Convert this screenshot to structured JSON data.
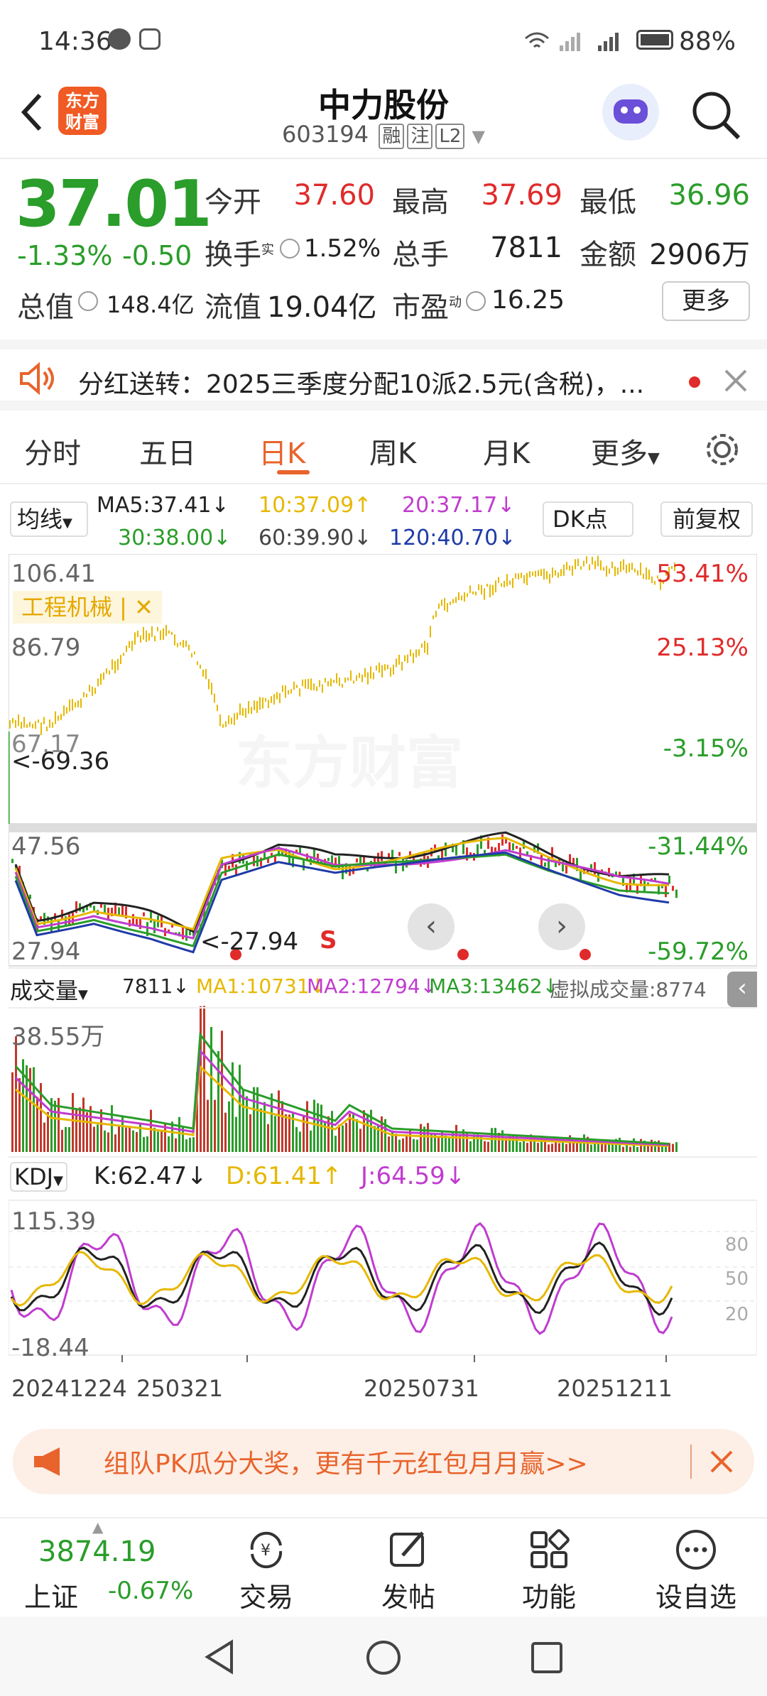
{
  "status": {
    "time": "14:36",
    "battery": "88%"
  },
  "header": {
    "title": "中力股份",
    "code": "603194",
    "tags": [
      "融",
      "注",
      "L2"
    ],
    "logo_line1": "东方",
    "logo_line2": "财富"
  },
  "quote": {
    "price": "37.01",
    "change_pct": "-1.33%",
    "change": "-0.50",
    "open_label": "今开",
    "open": "37.60",
    "high_label": "最高",
    "high": "37.69",
    "low_label": "最低",
    "low": "36.96",
    "turnover_label": "换手",
    "turnover_sup": "实",
    "turnover": "1.52%",
    "volume_label": "总手",
    "volume": "7811",
    "amount_label": "金额",
    "amount": "2906万",
    "mktcap_label": "总值",
    "mktcap": "148.4亿",
    "float_label": "流值",
    "float": "19.04亿",
    "pe_label": "市盈",
    "pe_sup": "动",
    "pe": "16.25",
    "more": "更多"
  },
  "notice": {
    "text": "分红送转：2025三季度分配10派2.5元(含税)，..."
  },
  "tabs": [
    "分时",
    "五日",
    "日K",
    "周K",
    "月K",
    "更多"
  ],
  "active_tab": "日K",
  "ma_bar": {
    "select": "均线",
    "ma5": "MA5:37.41↓",
    "ma10": "10:37.09↑",
    "ma20": "20:37.17↓",
    "ma30": "30:38.00↓",
    "ma60": "60:39.90↓",
    "ma120": "120:40.70↓",
    "dk": "DK点",
    "adjust": "前复权"
  },
  "upper_chart": {
    "y_top": "106.41",
    "y_mid": "86.79",
    "y_low": "67.17",
    "pct_top": "53.41%",
    "pct_mid": "25.13%",
    "pct_low": "-3.15%",
    "compare_label": "工程机械 |",
    "marker": "<-69.36",
    "watermark": "东方财富"
  },
  "kline": {
    "y_top": "47.56",
    "y_bottom": "27.94",
    "pct_top": "-31.44%",
    "pct_bottom": "-59.72%",
    "low_marker": "<-27.94",
    "sell_marker": "S"
  },
  "volume": {
    "select": "成交量",
    "v": "7811↓",
    "ma1": "MA1:10731↓",
    "ma2": "MA2:12794↓",
    "ma3": "MA3:13462↓",
    "virtual": "虚拟成交量:8774",
    "y_top": "38.55万"
  },
  "kdj": {
    "select": "KDJ",
    "k": "K:62.47↓",
    "d": "D:61.41↑",
    "j": "J:64.59↓",
    "y_top": "115.39",
    "y_bottom": "-18.44",
    "levels": [
      "80",
      "50",
      "20"
    ]
  },
  "dates": [
    "20241224",
    "250321",
    "20250731",
    "20251211"
  ],
  "banner": {
    "text": "组队PK瓜分大奖，更有千元红包月月赢>>"
  },
  "bottom": {
    "index_value": "3874.19",
    "index_name": "上证",
    "index_change": "-0.67%",
    "items": [
      "交易",
      "发帖",
      "功能",
      "设自选"
    ]
  },
  "colors": {
    "up": "#e02b2b",
    "down": "#2a9d2a",
    "accent": "#e8642c",
    "ma10": "#e6b800",
    "ma20": "#c03ccf"
  }
}
